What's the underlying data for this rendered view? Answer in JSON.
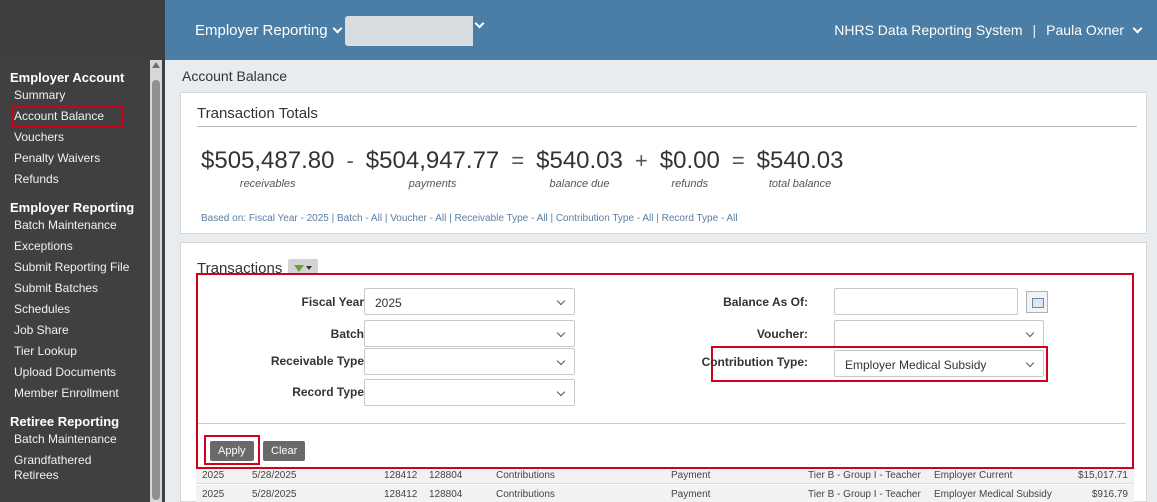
{
  "topbar": {
    "module_label": "Employer Reporting",
    "org_select_value": "",
    "system_name": "NHRS Data Reporting System",
    "separator": "|",
    "user_name": "Paula Oxner"
  },
  "sidebar": {
    "groups": [
      {
        "label": "Employer Account",
        "items": [
          "Summary",
          "Account Balance",
          "Vouchers",
          "Penalty Waivers",
          "Refunds"
        ]
      },
      {
        "label": "Employer Reporting",
        "items": [
          "Batch Maintenance",
          "Exceptions",
          "Submit Reporting File",
          "Submit Batches",
          "Schedules",
          "Job Share",
          "Tier Lookup",
          "Upload Documents",
          "Member Enrollment"
        ]
      },
      {
        "label": "Retiree Reporting",
        "items": [
          "Batch Maintenance",
          "Grandfathered",
          "Retirees"
        ]
      }
    ],
    "active_item": "Account Balance"
  },
  "page_title": "Account Balance",
  "totals": {
    "title": "Transaction Totals",
    "receivables": "$505,487.80",
    "receivables_label": "receivables",
    "payments": "$504,947.77",
    "payments_label": "payments",
    "balance_due": "$540.03",
    "balance_due_label": "balance due",
    "refunds": "$0.00",
    "refunds_label": "refunds",
    "total_balance": "$540.03",
    "total_balance_label": "total balance",
    "op_minus": "-",
    "op_eq": "=",
    "op_plus": "+",
    "based_on": "Based on: Fiscal Year - 2025 | Batch - All | Voucher - All | Receivable Type - All | Contribution Type - All | Record Type - All"
  },
  "transactions": {
    "title": "Transactions",
    "filters": {
      "fiscal_year_label": "Fiscal Year:",
      "fiscal_year_value": "2025",
      "batch_label": "Batch:",
      "batch_value": "",
      "receivable_type_label": "Receivable Type:",
      "receivable_type_value": "",
      "record_type_label": "Record Type:",
      "record_type_value": "",
      "balance_as_of_label": "Balance As Of:",
      "balance_as_of_value": "",
      "voucher_label": "Voucher:",
      "voucher_value": "",
      "contribution_type_label": "Contribution Type:",
      "contribution_type_value": "Employer Medical Subsidy"
    },
    "apply_label": "Apply",
    "clear_label": "Clear",
    "rows": [
      [
        "2025",
        "5/28/2025",
        "128412",
        "128804",
        "Contributions",
        "Payment",
        "Tier B - Group I - Teacher",
        "Employer Current",
        "$15,017.71"
      ],
      [
        "2025",
        "5/28/2025",
        "128412",
        "128804",
        "Contributions",
        "Payment",
        "Tier B - Group I - Teacher",
        "Employer Medical Subsidy",
        "$916.79"
      ]
    ]
  },
  "colors": {
    "topbar": "#4a7ea6",
    "sidebar": "#404040",
    "highlight": "#d0021b"
  }
}
